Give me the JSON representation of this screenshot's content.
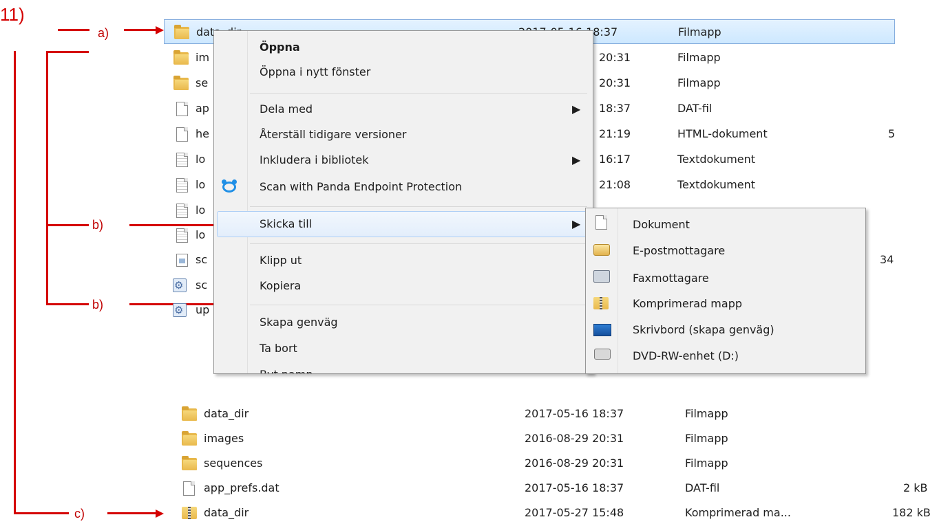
{
  "step_label": "11)",
  "annotations": {
    "a": "a)",
    "b1": "b)",
    "b2": "b)",
    "c": "c)"
  },
  "top_list": [
    {
      "name": "data_dir",
      "date": "2017-05-16 18:37",
      "type": "Filmapp",
      "size": "",
      "icon": "folder-icon"
    },
    {
      "name": "im",
      "date": "20:31",
      "type": "Filmapp",
      "size": "",
      "icon": "folder-icon"
    },
    {
      "name": "se",
      "date": "20:31",
      "type": "Filmapp",
      "size": "",
      "icon": "folder-icon"
    },
    {
      "name": "ap",
      "date": "18:37",
      "type": "DAT-fil",
      "size": "",
      "icon": "file-icon"
    },
    {
      "name": "he",
      "date": "21:19",
      "type": "HTML-dokument",
      "size": "5",
      "icon": "file-icon"
    },
    {
      "name": "lo",
      "date": "16:17",
      "type": "Textdokument",
      "size": "",
      "icon": "text-file-icon"
    },
    {
      "name": "lo",
      "date": "21:08",
      "type": "Textdokument",
      "size": "",
      "icon": "text-file-icon"
    },
    {
      "name": "lo",
      "date": "",
      "type": "",
      "size": "",
      "icon": "text-file-icon"
    },
    {
      "name": "lo",
      "date": "",
      "type": "",
      "size": "",
      "icon": "text-file-icon"
    },
    {
      "name": "sc",
      "date": "",
      "type": "",
      "size": "34",
      "icon": "image-file-icon"
    },
    {
      "name": "sc",
      "date": "",
      "type": "",
      "size": "",
      "icon": "script-file-icon"
    },
    {
      "name": "up",
      "date": "",
      "type": "",
      "size": "",
      "icon": "script-file-icon"
    }
  ],
  "context_menu": {
    "items": [
      "Öppna",
      "Öppna i nytt fönster",
      "Dela med",
      "Återställ tidigare versioner",
      "Inkludera i bibliotek",
      "Scan with Panda Endpoint Protection",
      "Skicka till",
      "Klipp ut",
      "Kopiera",
      "Skapa genväg",
      "Ta bort",
      "Byt namn"
    ]
  },
  "send_to_menu": {
    "items": [
      {
        "label": "Dokument",
        "icon": "documents-icon"
      },
      {
        "label": "E-postmottagare",
        "icon": "mail-recipient-icon"
      },
      {
        "label": "Faxmottagare",
        "icon": "fax-icon"
      },
      {
        "label": "Komprimerad mapp",
        "icon": "zip-folder-icon"
      },
      {
        "label": "Skrivbord (skapa genväg)",
        "icon": "desktop-icon"
      },
      {
        "label": "DVD-RW-enhet (D:)",
        "icon": "dvd-drive-icon"
      }
    ]
  },
  "bottom_list": [
    {
      "name": "data_dir",
      "date": "2017-05-16 18:37",
      "type": "Filmapp",
      "size": ""
    },
    {
      "name": "images",
      "date": "2016-08-29 20:31",
      "type": "Filmapp",
      "size": ""
    },
    {
      "name": "sequences",
      "date": "2016-08-29 20:31",
      "type": "Filmapp",
      "size": ""
    },
    {
      "name": "app_prefs.dat",
      "date": "2017-05-16 18:37",
      "type": "DAT-fil",
      "size": "2 kB"
    },
    {
      "name": "data_dir",
      "date": "2017-05-27 15:48",
      "type": "Komprimerad ma...",
      "size": "182 kB"
    }
  ]
}
